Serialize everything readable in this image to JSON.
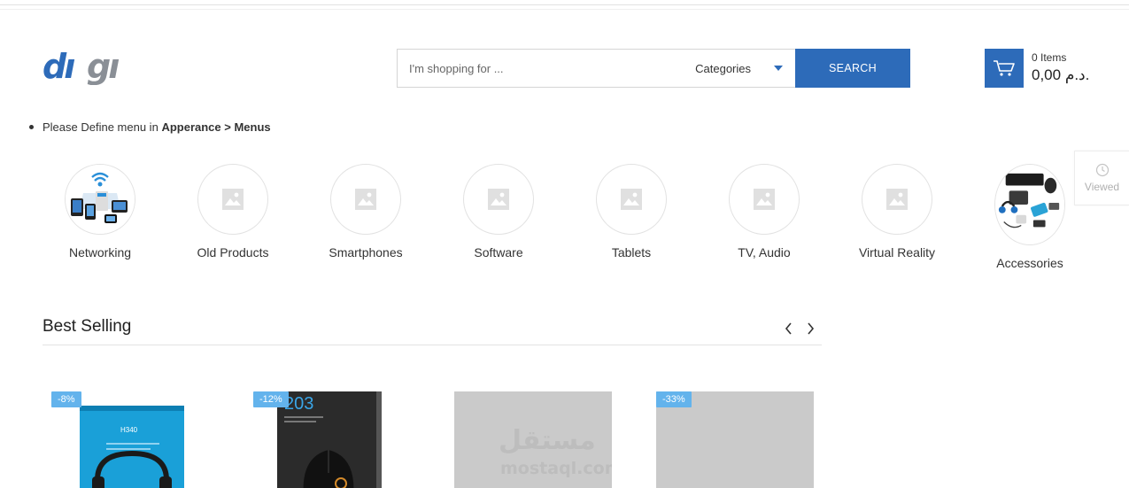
{
  "header": {
    "logo_text": "digi",
    "search": {
      "placeholder": "I'm shopping for ...",
      "category_label": "Categories",
      "button_label": "SEARCH"
    },
    "cart": {
      "count_label": "0 Items",
      "total": "0,00 د.م."
    }
  },
  "menu_notice": {
    "text": "Please Define menu in ",
    "bold": "Apperance > Menus"
  },
  "viewed": {
    "label": "Viewed"
  },
  "categories": [
    {
      "name": "Networking",
      "icon": "networking-devices-image"
    },
    {
      "name": "Old Products",
      "icon": "placeholder-image-icon"
    },
    {
      "name": "Smartphones",
      "icon": "placeholder-image-icon"
    },
    {
      "name": "Software",
      "icon": "placeholder-image-icon"
    },
    {
      "name": "Tablets",
      "icon": "placeholder-image-icon"
    },
    {
      "name": "TV, Audio",
      "icon": "placeholder-image-icon"
    },
    {
      "name": "Virtual Reality",
      "icon": "placeholder-image-icon"
    },
    {
      "name": "Accessories",
      "icon": "accessories-image"
    }
  ],
  "best_selling": {
    "title": "Best Selling",
    "products": [
      {
        "badge": "-8%",
        "image": "logitech-h340-headset",
        "box_text": "H340"
      },
      {
        "badge": "-12%",
        "image": "logitech-g203-mouse",
        "box_text": "203"
      },
      {
        "badge": "",
        "image": "placeholder-grey",
        "watermark_ar": "مستقل",
        "watermark_en": "mostaql.com"
      },
      {
        "badge": "-33%",
        "image": "placeholder-grey"
      }
    ]
  },
  "colors": {
    "primary": "#2d6bb9",
    "badge": "#63b3ec",
    "placeholder": "#cacaca"
  }
}
